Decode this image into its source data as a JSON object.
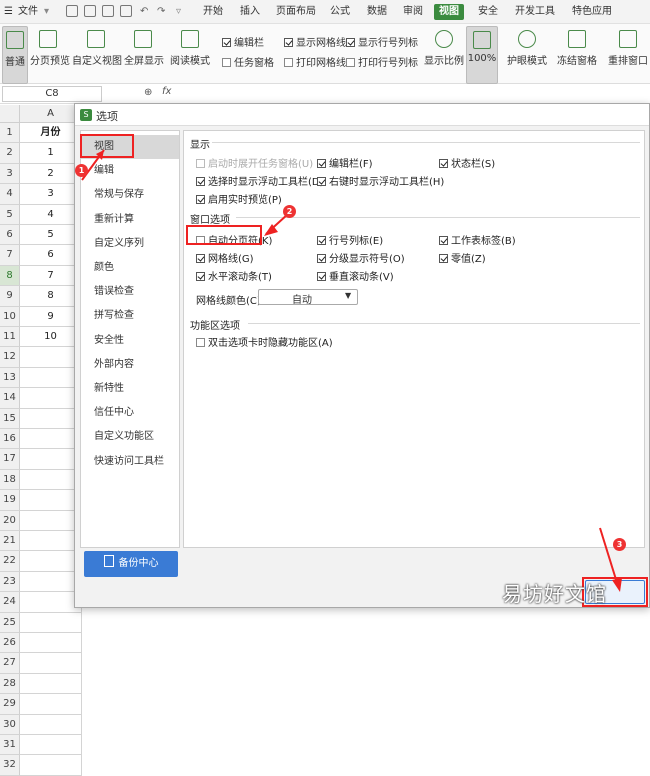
{
  "menubar": {
    "file_label": "文件",
    "tabs": [
      "开始",
      "插入",
      "页面布局",
      "公式",
      "数据",
      "审阅",
      "视图",
      "安全",
      "开发工具",
      "特色应用"
    ],
    "active_tab": "视图"
  },
  "ribbon": {
    "buttons": [
      "普通",
      "分页预览",
      "自定义视图",
      "全屏显示",
      "阅读模式"
    ],
    "checks": [
      {
        "label": "编辑栏",
        "checked": true
      },
      {
        "label": "任务窗格",
        "checked": false
      },
      {
        "label": "显示网格线",
        "checked": true
      },
      {
        "label": "打印网格线",
        "checked": false
      },
      {
        "label": "显示行号列标",
        "checked": true
      },
      {
        "label": "打印行号列标",
        "checked": false
      }
    ],
    "right_buttons": [
      "显示比例",
      "100%",
      "护眼模式",
      "冻结窗格",
      "重排窗口"
    ]
  },
  "formula_bar": {
    "cell_ref": "C8",
    "fx": "fx"
  },
  "sheet": {
    "col_a": "A",
    "header": "月份",
    "values": [
      "1",
      "2",
      "3",
      "4",
      "5",
      "6",
      "7",
      "8",
      "9",
      "10"
    ],
    "row_numbers": [
      "1",
      "2",
      "3",
      "4",
      "5",
      "6",
      "7",
      "8",
      "9",
      "10",
      "11",
      "12",
      "13",
      "14",
      "15",
      "16",
      "17",
      "18",
      "19",
      "20",
      "21",
      "22",
      "23",
      "24",
      "25",
      "26",
      "27",
      "28",
      "29",
      "30",
      "31",
      "32"
    ]
  },
  "dialog": {
    "title": "选项",
    "nav": [
      "视图",
      "编辑",
      "常规与保存",
      "重新计算",
      "自定义序列",
      "颜色",
      "错误检查",
      "拼写检查",
      "安全性",
      "外部内容",
      "新特性",
      "信任中心",
      "自定义功能区",
      "快速访问工具栏"
    ],
    "backup_label": "备份中心",
    "sections": {
      "display": "显示",
      "window": "窗口选项",
      "ribbon": "功能区选项"
    },
    "display_options": [
      {
        "label": "启动时展开任务窗格(U)",
        "checked": false,
        "disabled": true
      },
      {
        "label": "编辑栏(F)",
        "checked": true
      },
      {
        "label": "状态栏(S)",
        "checked": true
      },
      {
        "label": "选择时显示浮动工具栏(D)",
        "checked": true
      },
      {
        "label": "右键时显示浮动工具栏(H)",
        "checked": true
      },
      {
        "label": "启用实时预览(P)",
        "checked": true
      }
    ],
    "window_options": [
      {
        "label": "自动分页符(K)",
        "checked": false
      },
      {
        "label": "行号列标(E)",
        "checked": true
      },
      {
        "label": "工作表标签(B)",
        "checked": true
      },
      {
        "label": "网格线(G)",
        "checked": true
      },
      {
        "label": "分级显示符号(O)",
        "checked": true
      },
      {
        "label": "零值(Z)",
        "checked": true
      },
      {
        "label": "水平滚动条(T)",
        "checked": true
      },
      {
        "label": "垂直滚动条(V)",
        "checked": true
      }
    ],
    "gridline_color_label": "网格线颜色(C):",
    "gridline_color_value": "自动",
    "ribbon_options": [
      {
        "label": "双击选项卡时隐藏功能区(A)",
        "checked": false
      }
    ]
  },
  "annotations": {
    "badges": [
      "1",
      "2",
      "3"
    ],
    "watermark": "易坊好文馆"
  },
  "colors": {
    "accent": "#3b8b3f",
    "dialog_bg": "#f2f2f2",
    "backup_button": "#3a7bd5",
    "highlight": "#e22222"
  }
}
